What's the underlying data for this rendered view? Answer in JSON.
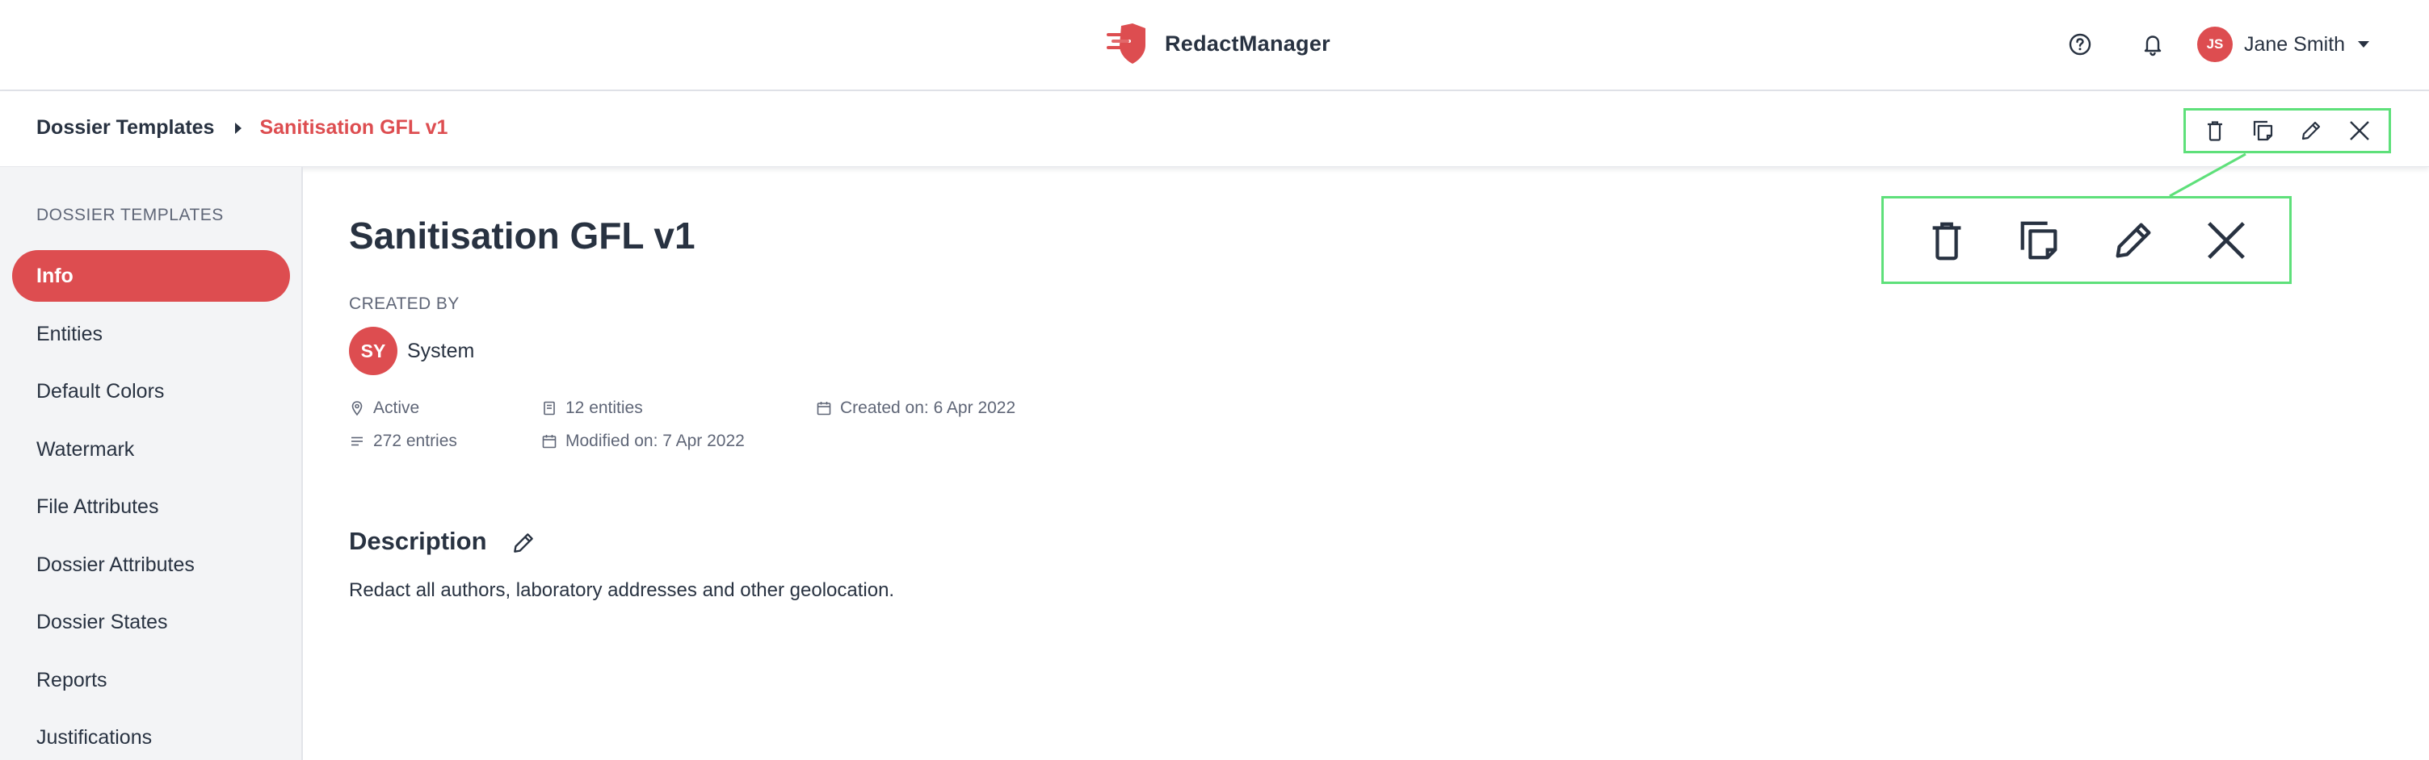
{
  "app": {
    "name": "RedactManager",
    "brand_color": "#dd4d50",
    "highlight_color": "#5ee07a"
  },
  "user": {
    "initials": "JS",
    "name": "Jane Smith"
  },
  "breadcrumb": {
    "root": "Dossier Templates",
    "current": "Sanitisation GFL v1"
  },
  "actions": [
    {
      "name": "delete",
      "icon": "trash-icon"
    },
    {
      "name": "clone",
      "icon": "copy-icon"
    },
    {
      "name": "edit",
      "icon": "pencil-icon"
    },
    {
      "name": "close",
      "icon": "close-icon"
    }
  ],
  "sidebar": {
    "title": "DOSSIER TEMPLATES",
    "items": [
      {
        "label": "Info",
        "active": true
      },
      {
        "label": "Entities",
        "active": false
      },
      {
        "label": "Default Colors",
        "active": false
      },
      {
        "label": "Watermark",
        "active": false
      },
      {
        "label": "File Attributes",
        "active": false
      },
      {
        "label": "Dossier Attributes",
        "active": false
      },
      {
        "label": "Dossier States",
        "active": false
      },
      {
        "label": "Reports",
        "active": false
      },
      {
        "label": "Justifications",
        "active": false
      }
    ]
  },
  "template": {
    "title": "Sanitisation GFL v1",
    "created_by_label": "CREATED BY",
    "creator_initials": "SY",
    "creator_name": "System",
    "stats": {
      "status": "Active",
      "entities": "12 entities",
      "created": "Created on: 6 Apr 2022",
      "entries": "272 entries",
      "modified": "Modified on: 7 Apr 2022"
    },
    "description_label": "Description",
    "description": "Redact all authors, laboratory addresses and other geolocation."
  }
}
